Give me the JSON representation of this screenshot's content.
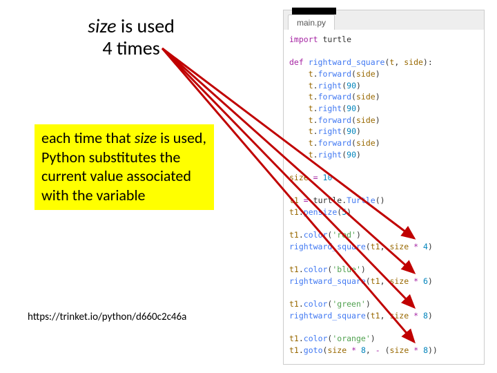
{
  "heading": {
    "part1": "size",
    "part2": " is used",
    "line2": "4 times"
  },
  "callout": {
    "pre": "each time that ",
    "ital": "size",
    "post": " is used, Python substitutes the current value associated with the variable"
  },
  "url": "https://trinket.io/python/d660c2c46a",
  "editor": {
    "tab": "main.py",
    "code": {
      "import_kw": "import",
      "turtle": " turtle",
      "def_kw": "def",
      "funcname": " rightward_square",
      "t": "t",
      "side": "side",
      "forward": "forward",
      "right": "right",
      "ninety": "90",
      "size_var": "size",
      "size_val": "10",
      "t1": "t1",
      "turtle_ctor": "Turtle",
      "pensize": "pensize",
      "pen_val": "5",
      "color": "color",
      "red": "'red'",
      "blue": "'blue'",
      "green": "'green'",
      "orange": "'orange'",
      "goto": "goto",
      "rsq": "rightward_square",
      "n4": "4",
      "n6": "6",
      "n8": "8"
    }
  }
}
